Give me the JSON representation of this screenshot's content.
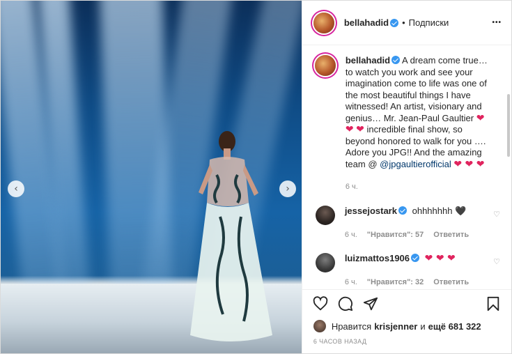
{
  "post": {
    "author": "bellahadid",
    "follow_label": "Подписки",
    "more_label": "•••"
  },
  "caption": {
    "username": "bellahadid",
    "text_1": "A dream come true… to watch you work and see your imagination come to life was one of the most beautiful things I have witnessed! An artist, visionary and genius… Mr. Jean-Paul Gaultier",
    "hearts_1": "❤ ❤",
    "hearts_2": "❤",
    "text_2": "incredible final show, so beyond honored to walk for you …. Adore you JPG!! And the amazing team @",
    "mention": "@jpgaultierofficial",
    "hearts_3": "❤ ❤ ❤",
    "time": "6 ч."
  },
  "comments": [
    {
      "username": "jessejostark",
      "text": "ohhhhhhh",
      "emoji": "🖤",
      "time": "6 ч.",
      "likes": "\"Нравится\": 57",
      "reply": "Ответить"
    },
    {
      "username": "luizmattos1906",
      "text": "❤ ❤ ❤",
      "time": "6 ч.",
      "likes": "\"Нравится\": 32",
      "reply": "Ответить"
    }
  ],
  "likes_line": {
    "prefix": "Нравится",
    "user": "krisjenner",
    "middle": "и",
    "rest": "ещё 681 322"
  },
  "posted_ago": "6 ЧАСОВ НАЗАД",
  "icons": {
    "like": "heart-icon",
    "comment": "comment-icon",
    "share": "share-icon",
    "save": "bookmark-icon",
    "prev": "chevron-left-icon",
    "next": "chevron-right-icon"
  },
  "colors": {
    "verified": "#3897f0",
    "heart": "#e0245e",
    "muted": "#8e8e8e"
  }
}
